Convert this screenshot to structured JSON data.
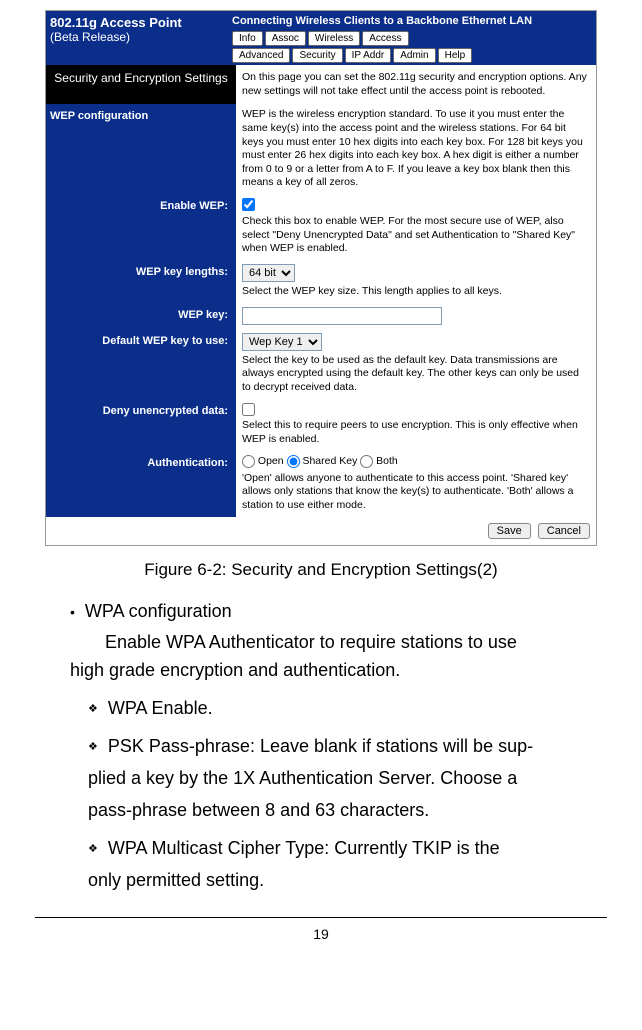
{
  "banner": {
    "title": "802.11g Access Point",
    "subtitle": "(Beta Release)",
    "tagline": "Connecting Wireless Clients to a Backbone Ethernet LAN",
    "tabs_row1": [
      "Info",
      "Assoc",
      "Wireless",
      "Access"
    ],
    "tabs_row2": [
      "Advanced",
      "Security",
      "IP Addr",
      "Admin",
      "Help"
    ]
  },
  "section_header": {
    "title": "Security and Encryption Settings",
    "desc": "On this page you can set the 802.11g security and encryption options. Any new settings will not take effect until the access point is rebooted."
  },
  "wep": {
    "heading": "WEP configuration",
    "intro": "WEP is the wireless encryption standard. To use it you must enter the same key(s) into the access point and the wireless stations. For 64 bit keys you must enter 10 hex digits into each key box. For 128 bit keys you must enter 26 hex digits into each key box. A hex digit is either a number from 0 to 9 or a letter from A to F. If you leave a key box blank then this means a key of all zeros.",
    "enable_label": "Enable WEP:",
    "enable_desc": "Check this box to enable WEP. For the most secure use of WEP, also select \"Deny Unencrypted Data\" and set Authentication to \"Shared Key\" when WEP is enabled.",
    "keylen_label": "WEP key lengths:",
    "keylen_value": "64 bit",
    "keylen_desc": "Select the WEP key size. This length applies to all keys.",
    "wepkey_label": "WEP key:",
    "defaultkey_label": "Default WEP key to use:",
    "defaultkey_value": "Wep Key 1",
    "defaultkey_desc": "Select the key to be used as the default key. Data transmissions are always encrypted using the default key. The other keys can only be used to decrypt received data.",
    "deny_label": "Deny unencrypted data:",
    "deny_desc": "Select this to require peers to use encryption. This is only effective when WEP is enabled.",
    "auth_label": "Authentication:",
    "auth_open": "Open",
    "auth_shared": "Shared Key",
    "auth_both": "Both",
    "auth_desc": "'Open' allows anyone to authenticate to this access point. 'Shared key' allows only stations that know the key(s) to authenticate. 'Both' allows a station to use either mode."
  },
  "buttons": {
    "save": "Save",
    "cancel": "Cancel"
  },
  "caption": "Figure 6-2: Security and Encryption Settings(2)",
  "wpa": {
    "heading": "WPA configuration",
    "intro_line1": "Enable WPA Authenticator to require stations to use",
    "intro_line2": "high grade encryption and authentication.",
    "item1": "WPA Enable.",
    "item2_a": "PSK Pass-phrase: Leave blank if stations will be sup-",
    "item2_b": "plied a key by the 1X Authentication Server. Choose a",
    "item2_c": "pass-phrase between 8 and 63 characters.",
    "item3_a": "WPA Multicast Cipher Type: Currently TKIP is the",
    "item3_b": "only permitted setting."
  },
  "page_number": "19"
}
